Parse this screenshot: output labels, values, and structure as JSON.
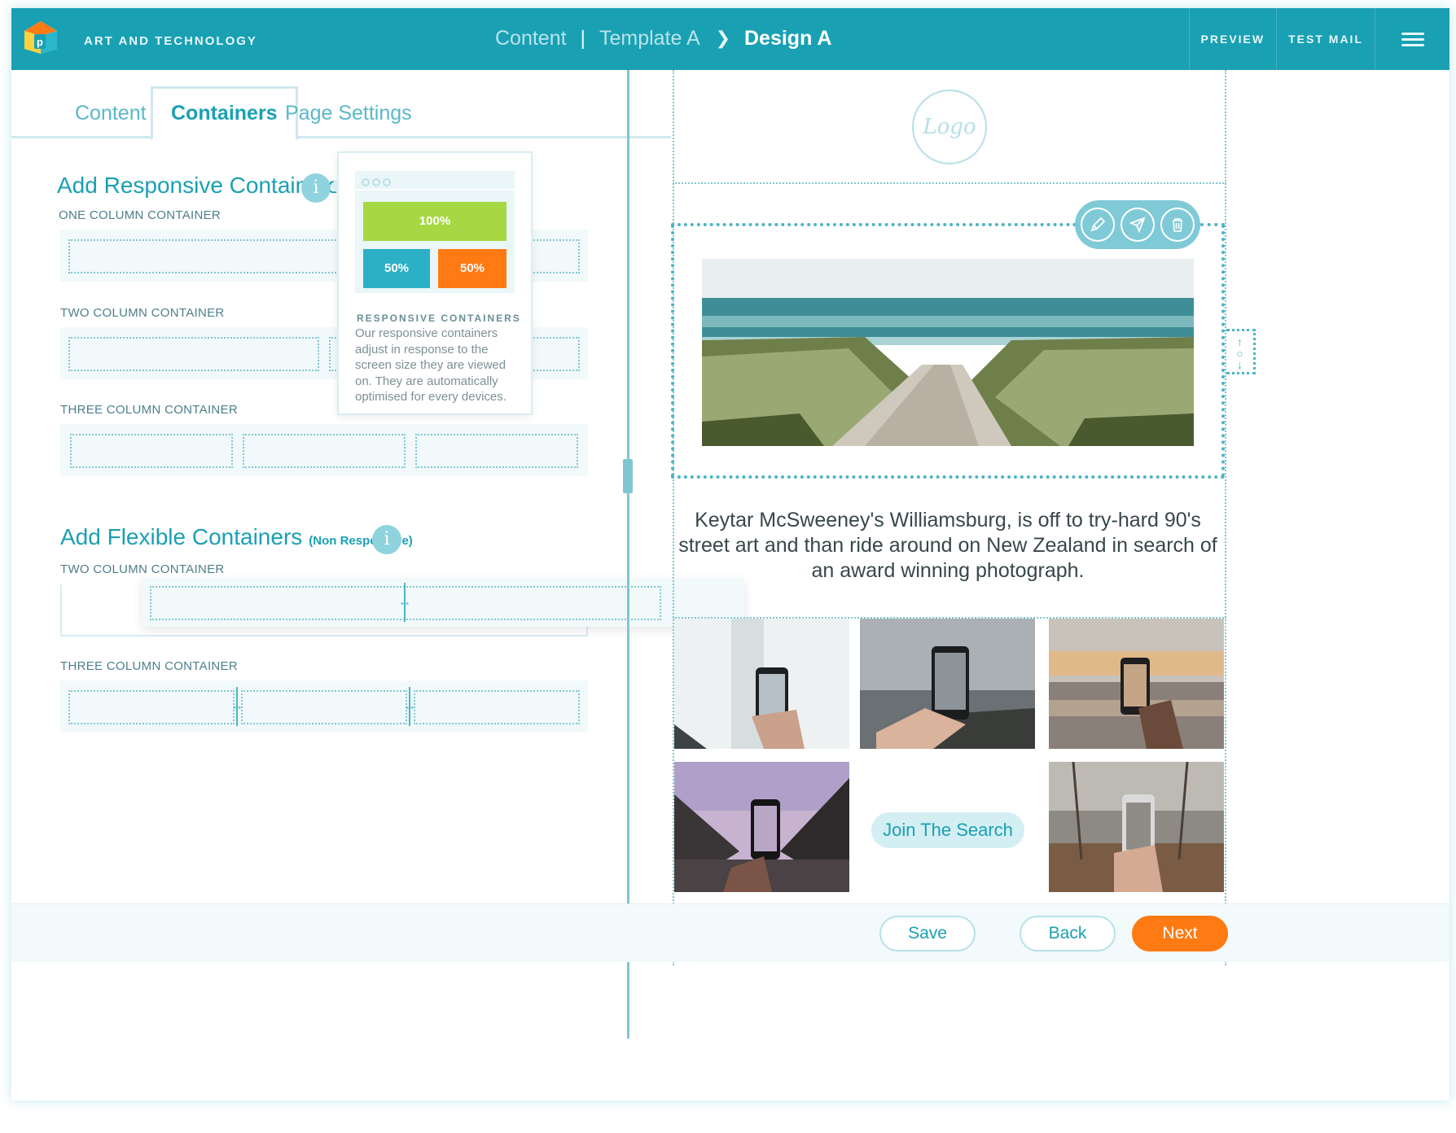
{
  "app": {
    "brand": "ART AND TECHNOLOGY",
    "breadcrumb": {
      "item1": "Content",
      "sep": "|",
      "item2": "Template A",
      "current": "Design A"
    },
    "actions": {
      "preview": "PREVIEW",
      "test_mail": "TEST MAIL"
    },
    "colors": {
      "primary": "#1aa0b3",
      "accent": "#ff7a13",
      "green": "#a6d843",
      "teal_block": "#1aa0b3"
    }
  },
  "tabs": [
    {
      "label": "Content",
      "active": false
    },
    {
      "label": "Containers",
      "active": true
    },
    {
      "label": "Page Settings",
      "active": false
    }
  ],
  "responsive": {
    "title": "Add Responsive Containers",
    "info_icon": "i",
    "one_col": "ONE COLUMN CONTAINER",
    "two_col": "TWO COLUMN CONTAINER",
    "three_col": "THREE COLUMN CONTAINER"
  },
  "tooltip": {
    "bar_full": "100%",
    "bar_half_a": "50%",
    "bar_half_b": "50%",
    "heading": "RESPONSIVE CONTAINERS",
    "body": "Our responsive containers adjust in response to the screen size they are viewed on. They are automatically optimised for every devices."
  },
  "flexible": {
    "title": "Add Flexible Containers",
    "subtitle": "(Non Responsive)",
    "info_icon": "i",
    "two_col": "TWO COLUMN CONTAINER",
    "three_col": "THREE COLUMN CONTAINER"
  },
  "preview": {
    "logo": "Logo",
    "story": "Keytar McSweeney's Williamsburg, is off to try-hard 90's street art and than ride around on New Zealand in search of an award winning photograph.",
    "cta": "Join The Search",
    "toolbar_icons": [
      "pencil-icon",
      "send-icon",
      "trash-icon"
    ]
  },
  "footer": {
    "save": "Save",
    "back": "Back",
    "next": "Next"
  }
}
